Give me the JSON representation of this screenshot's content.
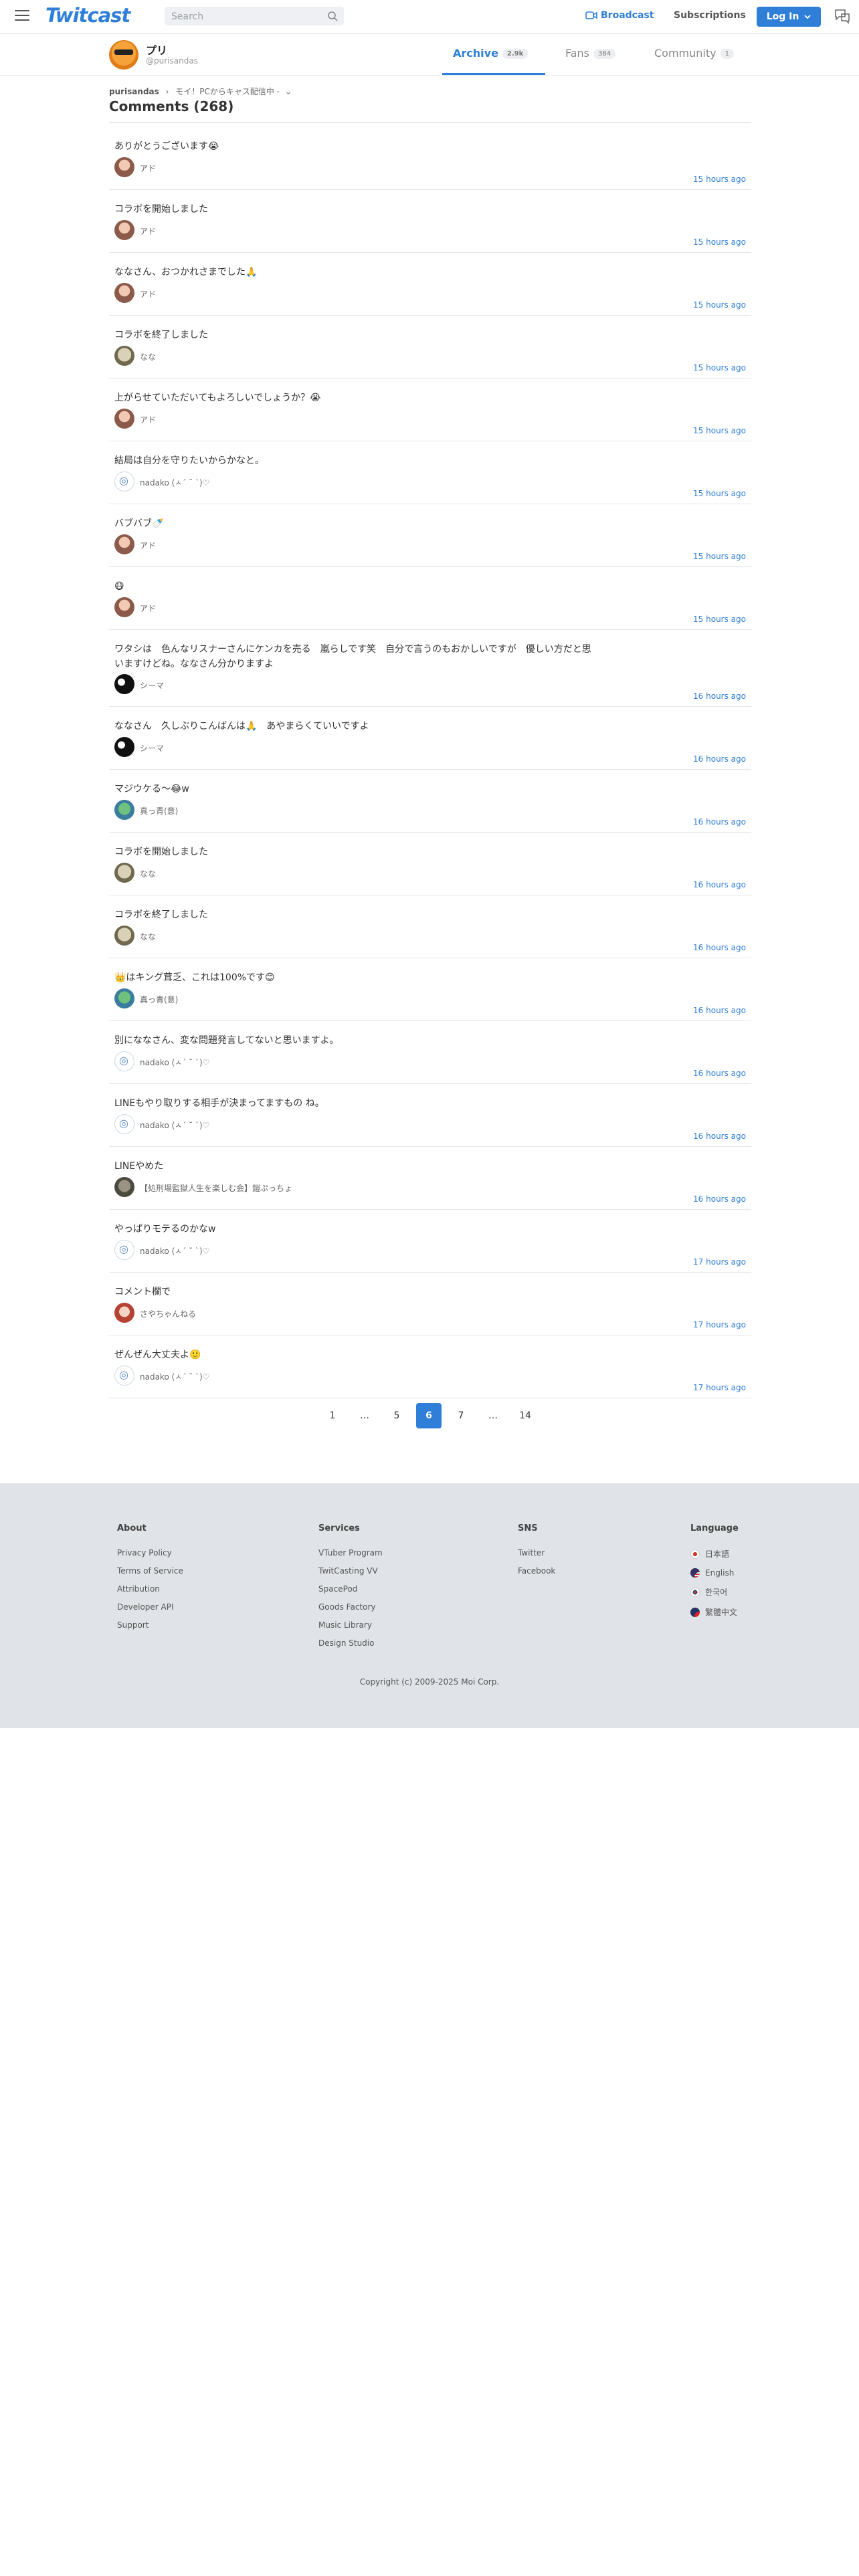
{
  "nav": {
    "logo": "Twitcast",
    "search_placeholder": "Search",
    "broadcast": "Broadcast",
    "subscriptions": "Subscriptions",
    "login": "Log In"
  },
  "user": {
    "name": "プリ",
    "id": "@purisandas",
    "tabs": [
      {
        "label": "Archive",
        "count": "2.9k"
      },
      {
        "label": "Fans",
        "count": "384"
      },
      {
        "label": "Community",
        "count": "1"
      }
    ]
  },
  "breadcrumb": {
    "user": "purisandas",
    "sep": "›",
    "title": "モイ！PCからキャス配信中 -",
    "chev": "⌄"
  },
  "comments_title": "Comments (268)",
  "comments": [
    {
      "text": "ありがとうございます😭",
      "name": "アド",
      "time": "15 hours ago",
      "av": "ado"
    },
    {
      "text": "コラボを開始しました",
      "name": "アド",
      "time": "15 hours ago",
      "av": "ado"
    },
    {
      "text": "ななさん、おつかれさまでした🙏",
      "name": "アド",
      "time": "15 hours ago",
      "av": "ado"
    },
    {
      "text": "コラボを終了しました",
      "name": "なな",
      "time": "15 hours ago",
      "av": "nana"
    },
    {
      "text": "上がらせていただいてもよろしいでしょうか？😭",
      "name": "アド",
      "time": "15 hours ago",
      "av": "ado"
    },
    {
      "text": "結局は自分を守りたいからかなと。",
      "name": "nadako (ㅅ´ ˘ `)♡",
      "time": "15 hours ago",
      "av": "nadako"
    },
    {
      "text": "バブバブ🍼",
      "name": "アド",
      "time": "15 hours ago",
      "av": "ado"
    },
    {
      "text": "😷",
      "name": "アド",
      "time": "15 hours ago",
      "av": "ado"
    },
    {
      "text": "ワタシは　色んなリスナーさんにケンカを売る　嵐らしです笑　自分で言うのもおかしいですが　優しい方だと思いますけどね。ななさん分かりますよ",
      "name": "シーマ",
      "time": "16 hours ago",
      "av": "cima"
    },
    {
      "text": "ななさん　久しぶりこんばんは🙏　あやまらくていいですよ",
      "name": "シーマ",
      "time": "16 hours ago",
      "av": "cima"
    },
    {
      "text": "マジウケる〜😂w",
      "name": "真っ青(意)",
      "time": "16 hours ago",
      "av": "ma"
    },
    {
      "text": "コラボを開始しました",
      "name": "なな",
      "time": "16 hours ago",
      "av": "nana"
    },
    {
      "text": "コラボを終了しました",
      "name": "なな",
      "time": "16 hours ago",
      "av": "nana"
    },
    {
      "text": "👑はキング茸乏、これは100%です😊",
      "name": "真っ青(意)",
      "time": "16 hours ago",
      "av": "ma"
    },
    {
      "text": "別にななさん、変な問題発言してないと思いますよ。",
      "name": "nadako (ㅅ´ ˘ `)♡",
      "time": "16 hours ago",
      "av": "nadako"
    },
    {
      "text": "LINEもやり取りする相手が決まってますもの ね。",
      "name": "nadako (ㅅ´ ˘ `)♡",
      "time": "16 hours ago",
      "av": "nadako"
    },
    {
      "text": "LINEやめた",
      "name": "【処刑場監獄人生を楽しむ会】鎧ぷっちょ",
      "time": "16 hours ago",
      "av": "kai"
    },
    {
      "text": "やっぱりモテるのかなw",
      "name": "nadako (ㅅ´ ˘ `)♡",
      "time": "17 hours ago",
      "av": "nadako"
    },
    {
      "text": "コメント欄で",
      "name": "さやちゃんねる",
      "time": "17 hours ago",
      "av": "saya"
    },
    {
      "text": "ぜんぜん大丈夫よ🙂",
      "name": "nadako (ㅅ´ ˘ `)♡",
      "time": "17 hours ago",
      "av": "nadako"
    }
  ],
  "pagination": [
    "1",
    "…",
    "5",
    "6",
    "7",
    "…",
    "14"
  ],
  "current_page": "6",
  "footer": {
    "about": {
      "title": "About",
      "links": [
        "Privacy Policy",
        "Terms of Service",
        "Attribution",
        "Developer API",
        "Support"
      ]
    },
    "services": {
      "title": "Services",
      "links": [
        "VTuber Program",
        "TwitCasting VV",
        "SpacePod",
        "Goods Factory",
        "Music Library",
        "Design Studio"
      ]
    },
    "sns": {
      "title": "SNS",
      "links": [
        "Twitter",
        "Facebook"
      ]
    },
    "language": {
      "title": "Language",
      "links": [
        "日本語",
        "English",
        "한국어",
        "繁體中文"
      ]
    },
    "copyright": "Copyright (c) 2009-2025 Moi Corp."
  },
  "colors": {
    "accent": "#2f7fd8",
    "footer_bg": "#e0e3e7"
  }
}
